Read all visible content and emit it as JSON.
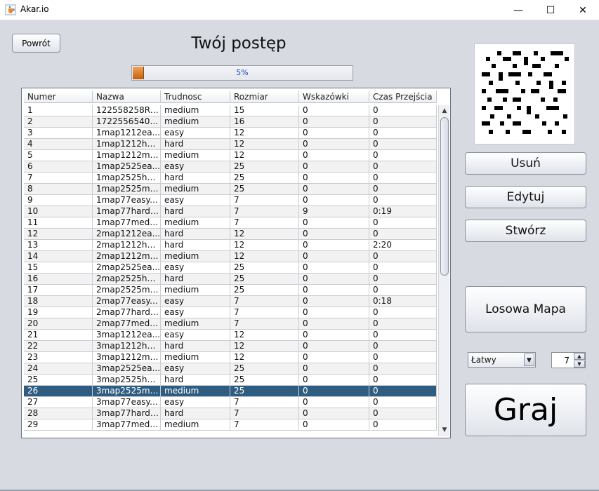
{
  "window": {
    "title": "Akar.io",
    "controls": {
      "minimize": "—",
      "maximize": "☐",
      "close": "✕"
    }
  },
  "header": {
    "back_label": "Powrót",
    "title": "Twój postęp",
    "progress_value": 0.05,
    "progress_label": "5%"
  },
  "table": {
    "columns": [
      "Numer",
      "Nazwa",
      "Trudnosc",
      "Rozmiar",
      "Wskazówki",
      "Czas Przejścia"
    ],
    "selected_row_index": 25,
    "rows": [
      [
        "1",
        "122558258Ra...",
        "medium",
        "15",
        "0",
        "0"
      ],
      [
        "2",
        "1722556540R...",
        "medium",
        "16",
        "0",
        "0"
      ],
      [
        "3",
        "1map1212ea...",
        "easy",
        "12",
        "0",
        "0"
      ],
      [
        "4",
        "1map1212har...",
        "hard",
        "12",
        "0",
        "0"
      ],
      [
        "5",
        "1map1212me...",
        "medium",
        "12",
        "0",
        "0"
      ],
      [
        "6",
        "1map2525ea...",
        "easy",
        "25",
        "0",
        "0"
      ],
      [
        "7",
        "1map2525har...",
        "hard",
        "25",
        "0",
        "0"
      ],
      [
        "8",
        "1map2525me...",
        "medium",
        "25",
        "0",
        "0"
      ],
      [
        "9",
        "1map77easy....",
        "easy",
        "7",
        "0",
        "0"
      ],
      [
        "10",
        "1map77hard....",
        "hard",
        "7",
        "9",
        "0:19"
      ],
      [
        "11",
        "1map77medi...",
        "medium",
        "7",
        "0",
        "0"
      ],
      [
        "12",
        "2map1212ea...",
        "hard",
        "12",
        "0",
        "0"
      ],
      [
        "13",
        "2map1212har...",
        "hard",
        "12",
        "0",
        "2:20"
      ],
      [
        "14",
        "2map1212me...",
        "medium",
        "12",
        "0",
        "0"
      ],
      [
        "15",
        "2map2525ea...",
        "easy",
        "25",
        "0",
        "0"
      ],
      [
        "16",
        "2map2525har...",
        "hard",
        "25",
        "0",
        "0"
      ],
      [
        "17",
        "2map2525me...",
        "medium",
        "25",
        "0",
        "0"
      ],
      [
        "18",
        "2map77easy....",
        "easy",
        "7",
        "0",
        "0:18"
      ],
      [
        "19",
        "2map77hard....",
        "easy",
        "7",
        "0",
        "0"
      ],
      [
        "20",
        "2map77medi...",
        "medium",
        "7",
        "0",
        "0"
      ],
      [
        "21",
        "3map1212ea...",
        "easy",
        "12",
        "0",
        "0"
      ],
      [
        "22",
        "3map1212har...",
        "hard",
        "12",
        "0",
        "0"
      ],
      [
        "23",
        "3map1212me...",
        "medium",
        "12",
        "0",
        "0"
      ],
      [
        "24",
        "3map2525ea...",
        "easy",
        "25",
        "0",
        "0"
      ],
      [
        "25",
        "3map2525har...",
        "hard",
        "25",
        "0",
        "0"
      ],
      [
        "26",
        "3map2525me...",
        "medium",
        "25",
        "0",
        "0"
      ],
      [
        "27",
        "3map77easy....",
        "easy",
        "7",
        "0",
        "0"
      ],
      [
        "28",
        "3map77hard....",
        "hard",
        "7",
        "0",
        "0"
      ],
      [
        "29",
        "3map77medi...",
        "medium",
        "7",
        "0",
        "0"
      ]
    ]
  },
  "sidebar": {
    "delete_label": "Usuń",
    "edit_label": "Edytuj",
    "create_label": "Stwórz",
    "random_map_label": "Losowa Mapa",
    "difficulty_selected": "Łatwy",
    "size_value": "7",
    "play_label": "Graj"
  },
  "icons": {
    "app": "java-cup-icon",
    "scroll_up": "scroll-up-arrow-icon",
    "scroll_down": "scroll-down-arrow-icon",
    "dropdown": "chevron-down-icon"
  },
  "colors": {
    "window_bg": "#d7dae1",
    "selected_row": "#2f5d82",
    "progress_fill": "#e07f2a",
    "progress_text": "#2040c0"
  }
}
